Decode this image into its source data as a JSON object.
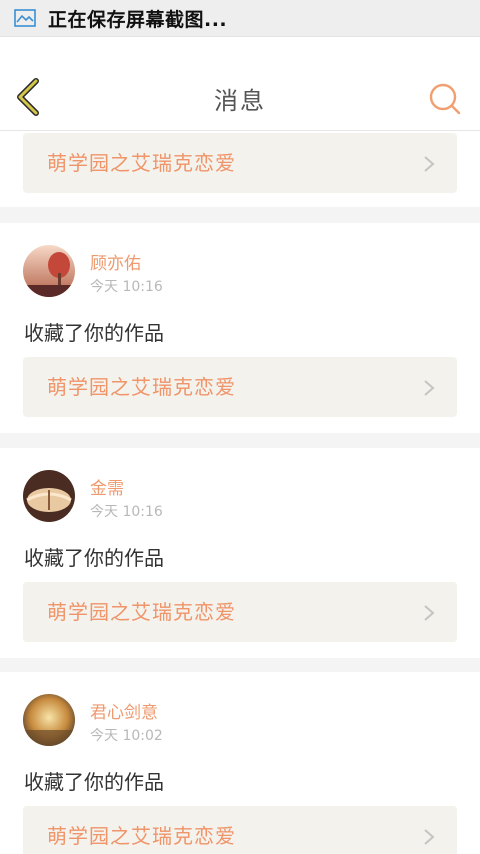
{
  "status_bar": {
    "text": "正在保存屏幕截图..."
  },
  "header": {
    "title": "消息"
  },
  "top_card": {
    "work_title": "萌学园之艾瑞克恋爱"
  },
  "notifications": [
    {
      "user": "顾亦佑",
      "time": "今天 10:16",
      "message": "收藏了你的作品",
      "work_title": "萌学园之艾瑞克恋爱"
    },
    {
      "user": "金需",
      "time": "今天 10:16",
      "message": "收藏了你的作品",
      "work_title": "萌学园之艾瑞克恋爱"
    },
    {
      "user": "君心剑意",
      "time": "今天 10:02",
      "message": "收藏了你的作品",
      "work_title": "萌学园之艾瑞克恋爱"
    }
  ],
  "colors": {
    "accent": "#f0946a",
    "username": "#ee9a6e",
    "back_icon": "#d4c84a",
    "work_box_bg": "#f3f2ec"
  },
  "icons": {
    "status": "screenshot-icon",
    "back": "chevron-left-icon",
    "search": "search-icon",
    "row_arrow": "chevron-right-icon"
  }
}
